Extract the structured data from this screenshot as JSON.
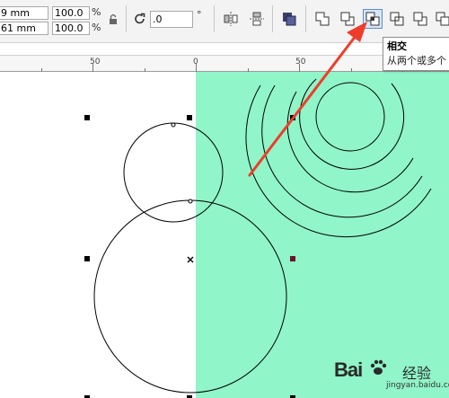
{
  "property_bar": {
    "width_value": "9 mm",
    "height_value": "61 mm",
    "scale_x": "100.0",
    "scale_y": "100.0",
    "percent_symbol": "%",
    "rotation_value": ".0",
    "degree_symbol": "°"
  },
  "tooltip": {
    "title": "相交",
    "description": "从两个或多个"
  },
  "ruler": {
    "labels": [
      "50",
      "0",
      "50"
    ]
  },
  "colors": {
    "page_fill": "#90f5c8",
    "arrow": "#f03c2a",
    "active_node": "#6d1430"
  },
  "watermark": {
    "logo_text": "Bai",
    "chinese_text": "经验",
    "url": "jingyan.baidu.com"
  }
}
